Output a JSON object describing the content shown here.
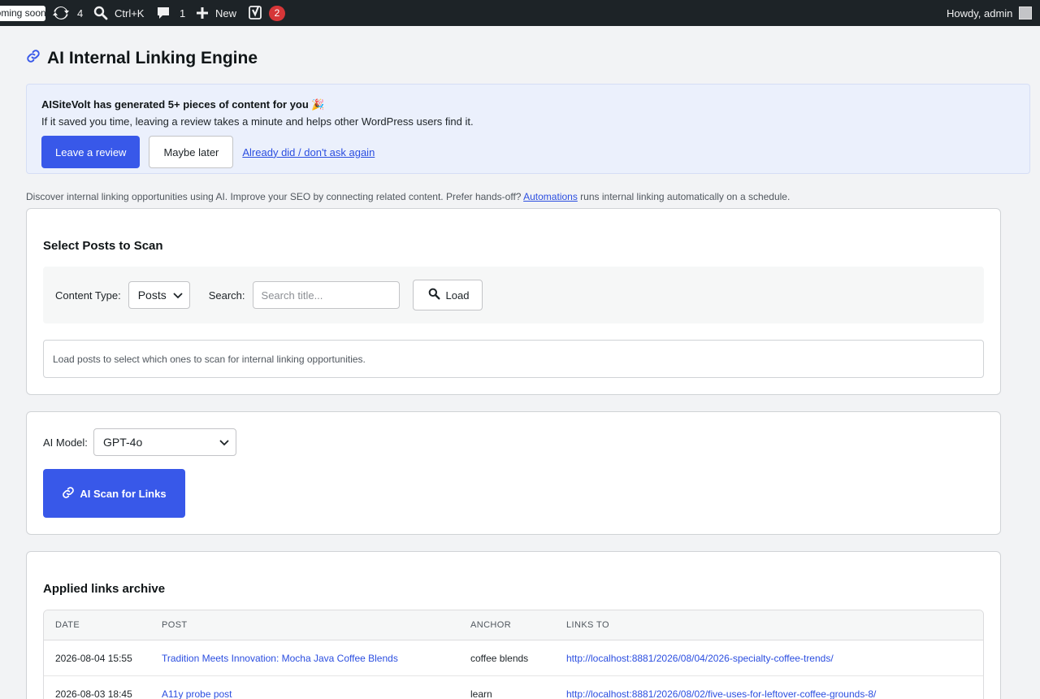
{
  "adminbar": {
    "coming_soon": "Coming soon",
    "updates_count": "4",
    "search_shortcut": "Ctrl+K",
    "comments_count": "1",
    "new_label": "New",
    "seo_badge": "2",
    "howdy": "Howdy, admin"
  },
  "page": {
    "title": "AI Internal Linking Engine"
  },
  "notice": {
    "headline": "AISiteVolt has generated 5+ pieces of content for you 🎉",
    "subline": "If it saved you time, leaving a review takes a minute and helps other WordPress users find it.",
    "review_button": "Leave a review",
    "later_button": "Maybe later",
    "dismiss_link": "Already did / don't ask again"
  },
  "intro": {
    "text_before": "Discover internal linking opportunities using AI. Improve your SEO by connecting related content. Prefer hands-off?",
    "link": "Automations",
    "text_after": "runs internal linking automatically on a schedule."
  },
  "select_posts": {
    "title": "Select Posts to Scan",
    "content_type_label": "Content Type:",
    "content_type_value": "Posts",
    "search_label": "Search:",
    "search_placeholder": "Search title...",
    "load_button": "Load",
    "empty_message": "Load posts to select which ones to scan for internal linking opportunities."
  },
  "ai": {
    "model_label": "AI Model:",
    "model_value": "GPT-4o",
    "scan_button": "AI Scan for Links"
  },
  "archive": {
    "title": "Applied links archive",
    "columns": [
      "DATE",
      "POST",
      "ANCHOR",
      "LINKS TO"
    ],
    "rows": [
      {
        "date": "2026-08-04 15:55",
        "post": "Tradition Meets Innovation: Mocha Java Coffee Blends",
        "anchor": "coffee blends",
        "links_to": "http://localhost:8881/2026/08/04/2026-specialty-coffee-trends/"
      },
      {
        "date": "2026-08-03 18:45",
        "post": "A11y probe post",
        "anchor": "learn",
        "links_to": "http://localhost:8881/2026/08/02/five-uses-for-leftover-coffee-grounds-8/"
      }
    ]
  },
  "colors": {
    "accent": "#3858e9",
    "adminbar": "#1d2327",
    "badge": "#d63638",
    "notice_bg": "#ebf0fc"
  }
}
